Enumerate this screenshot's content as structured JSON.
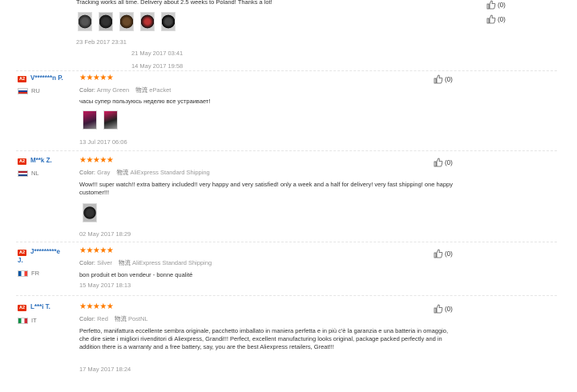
{
  "top_review": {
    "text": "Tracking works all time. Delivery about 2.5 weeks to Poland! Thanks a lot!",
    "date": "23 Feb 2017 23:31",
    "helpful_counts": [
      "(0)",
      "(0)"
    ]
  },
  "extra_dates": [
    "21 May 2017 03:41",
    "14 May 2017 19:58"
  ],
  "meta_labels": {
    "color": "Color:",
    "shipping": "物流"
  },
  "reviews": [
    {
      "badge": "A2",
      "name": "V*******n P.",
      "country": "RU",
      "stars": "★★★★★",
      "color": "Army Green",
      "shipping": "ePacket",
      "text": "часы супер пользуюсь неделю все устраивает!",
      "date": "13 Jul 2017 06:06",
      "helpful": "(0)"
    },
    {
      "badge": "A2",
      "name": "M**k Z.",
      "country": "NL",
      "stars": "★★★★★",
      "color": "Gray",
      "shipping": "AliExpress Standard Shipping",
      "text": "Wow!!! super watch!! extra battery included!! very happy and very satisfied! only a week and a half for delivery! very fast shipping! one happy customer!!!",
      "date": "02 May 2017 18:29",
      "helpful": "(0)"
    },
    {
      "badge": "A2",
      "name": "J*********e",
      "name2": "J.",
      "country": "FR",
      "stars": "★★★★★",
      "color": "Silver",
      "shipping": "AliExpress Standard Shipping",
      "text": "bon produit et bon vendeur - bonne qualité",
      "date": "15 May 2017 18:13",
      "helpful": "(0)"
    },
    {
      "badge": "A2",
      "name": "L***i T.",
      "country": "IT",
      "stars": "★★★★★",
      "color": "Red",
      "shipping": "PostNL",
      "text": "Perfetto, manifattura eccellente sembra originale, pacchetto imballato in maniera perfetta e in più c'è la garanzia e una batteria in omaggio, che dire siete i migliori rivenditori di Aliexpress, Grandi!!! Perfect, excellent manufacturing looks original, package packed perfectly and in addition there is a warranty and a free battery, say, you are the best Aliexpress retailers, Great!!!",
      "date": "17 May 2017 18:24",
      "helpful": "(0)"
    }
  ],
  "colors": {
    "stars": "#ff7c00",
    "name": "#2a6ebb",
    "badge": "#e62e04"
  },
  "icons": {
    "helpful": "thumbs-up-icon"
  }
}
